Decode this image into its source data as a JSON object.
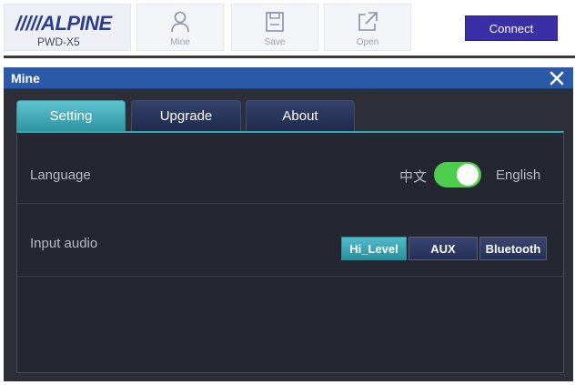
{
  "brand": {
    "logo_text": "/////ALPINE",
    "model": "PWD-X5"
  },
  "toolbar": {
    "mine_label": "Mine",
    "save_label": "Save",
    "open_label": "Open",
    "connect_label": "Connect"
  },
  "dialog": {
    "title": "Mine",
    "close_symbol": "✕",
    "tabs": [
      {
        "label": "Setting",
        "active": true
      },
      {
        "label": "Upgrade",
        "active": false
      },
      {
        "label": "About",
        "active": false
      }
    ]
  },
  "settings": {
    "language": {
      "label": "Language",
      "option_left": "中文",
      "option_right": "English",
      "toggle_on": true
    },
    "input_audio": {
      "label": "Input audio",
      "options": [
        "Hi_Level",
        "AUX",
        "Bluetooth"
      ],
      "selected": "Hi_Level"
    }
  },
  "colors": {
    "brand_blue": "#2b3d8f",
    "connect_button": "#3a2fa6",
    "titlebar": "#2a5aa8",
    "active_teal": "#3aa6b4",
    "toggle_green": "#4cce4c",
    "dialog_bg": "#2d2f38"
  },
  "icons": {
    "mine": "person-icon",
    "save": "save-icon",
    "open": "open-icon",
    "close": "close-icon"
  }
}
